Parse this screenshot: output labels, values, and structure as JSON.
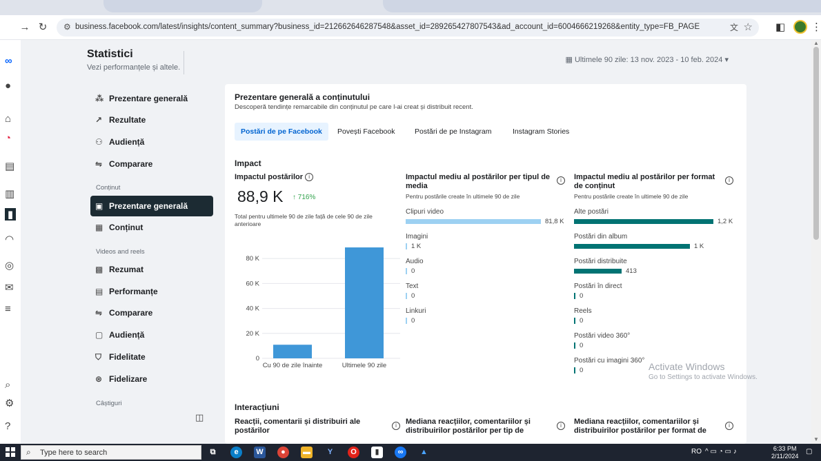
{
  "browser": {
    "url": "business.facebook.com/latest/insights/content_summary?business_id=212662646287548&asset_id=289265427807543&ad_account_id=6004666219268&entity_type=FB_PAGE"
  },
  "page": {
    "title": "Statistici",
    "subtitle": "Vezi performanțele și altele.",
    "date_range": "Ultimele 90 zile: 13 nov. 2023 - 10 feb. 2024"
  },
  "sidebar": {
    "items": [
      {
        "label": "Prezentare generală",
        "icon": "nodes-icon"
      },
      {
        "label": "Rezultate",
        "icon": "trend-icon"
      },
      {
        "label": "Audiență",
        "icon": "people-icon"
      },
      {
        "label": "Comparare",
        "icon": "compare-icon"
      }
    ],
    "section_continut": "Conținut",
    "continut_items": [
      {
        "label": "Prezentare generală",
        "icon": "overview-icon"
      },
      {
        "label": "Conținut",
        "icon": "table-icon"
      }
    ],
    "section_videos": "Videos and reels",
    "video_items": [
      {
        "label": "Rezumat",
        "icon": "grid-icon"
      },
      {
        "label": "Performanțe",
        "icon": "list-icon"
      },
      {
        "label": "Comparare",
        "icon": "compare-icon"
      },
      {
        "label": "Audiență",
        "icon": "video-audience-icon"
      },
      {
        "label": "Fidelitate",
        "icon": "shield-icon"
      },
      {
        "label": "Fidelizare",
        "icon": "badge-icon"
      }
    ],
    "section_castiguri": "Câștiguri"
  },
  "card": {
    "title": "Prezentare generală a conținutului",
    "subtitle": "Descoperă tendințe remarcabile din conținutul pe care l-ai creat și distribuit recent.",
    "tabs": [
      "Postări de pe Facebook",
      "Povești Facebook",
      "Postări de pe Instagram",
      "Instagram Stories"
    ],
    "impact_heading": "Impact",
    "impact": {
      "title": "Impactul postărilor",
      "value": "88,9 K",
      "delta": "↑ 716%",
      "note": "Total pentru ultimele 90 de zile față de cele 90 de zile anterioare"
    },
    "by_type": {
      "title": "Impactul mediu al postărilor per tipul de media",
      "note": "Pentru postările create în ultimele 90 de zile",
      "rows": [
        {
          "label": "Clipuri video",
          "value": "81,8 K",
          "frac": 1.0
        },
        {
          "label": "Imagini",
          "value": "1 K",
          "frac": 0
        },
        {
          "label": "Audio",
          "value": "0",
          "frac": 0
        },
        {
          "label": "Text",
          "value": "0",
          "frac": 0
        },
        {
          "label": "Linkuri",
          "value": "0",
          "frac": 0
        }
      ]
    },
    "by_format": {
      "title": "Impactul mediu al postărilor per format de conținut",
      "note": "Pentru postările create în ultimele 90 de zile",
      "rows": [
        {
          "label": "Alte postări",
          "value": "1,2 K",
          "frac": 1.0
        },
        {
          "label": "Postări din album",
          "value": "1 K",
          "frac": 0.83
        },
        {
          "label": "Postări distribuite",
          "value": "413",
          "frac": 0.34
        },
        {
          "label": "Postări în direct",
          "value": "0",
          "frac": 0
        },
        {
          "label": "Reels",
          "value": "0",
          "frac": 0
        },
        {
          "label": "Postări video 360°",
          "value": "0",
          "frac": 0
        },
        {
          "label": "Postări cu imagini 360°",
          "value": "0",
          "frac": 0
        }
      ]
    },
    "interactions_heading": "Interacțiuni",
    "interactions": [
      "Reacții, comentarii și distribuiri ale postărilor",
      "Mediana reacțiilor, comentariilor și distribuirilor postărilor per tip de",
      "Mediana reacțiilor, comentariilor și distribuirilor postărilor per format de"
    ]
  },
  "chart_data": {
    "type": "bar",
    "categories": [
      "Cu 90 de zile înainte",
      "Ultimele 90 zile"
    ],
    "values": [
      10900,
      88900
    ],
    "yticks": [
      "0",
      "20 K",
      "40 K",
      "60 K",
      "80 K"
    ],
    "ylim": [
      0,
      95000
    ],
    "color": "#3f97d8"
  },
  "watermark": {
    "line1": "Activate Windows",
    "line2": "Go to Settings to activate Windows."
  },
  "taskbar": {
    "search_placeholder": "Type here to search",
    "tray_text": "RO",
    "time": "6:33 PM",
    "date": "2/11/2024"
  }
}
